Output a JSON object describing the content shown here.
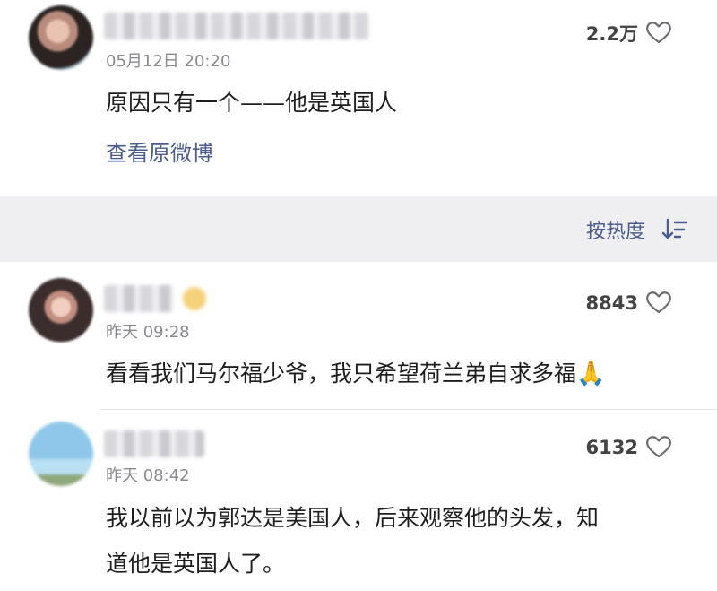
{
  "top_comment": {
    "time": "05月12日 20:20",
    "likes": "2.2万",
    "text": "原因只有一个——他是英国人",
    "view_original": "查看原微博"
  },
  "sort": {
    "label": "按热度"
  },
  "comments": [
    {
      "time": "昨天 09:28",
      "likes": "8843",
      "text": "看看我们马尔福少爷，我只希望荷兰弟自求多福",
      "emoji": "🙏"
    },
    {
      "time": "昨天 08:42",
      "likes": "6132",
      "text_line1": "我以前以为郭达是美国人，后来观察他的头发，知",
      "text_line2": "道他是英国人了。"
    }
  ],
  "icons": {
    "heart": "heart-outline-icon",
    "sort": "sort-descending-icon"
  },
  "colors": {
    "link": "#4a5b8c",
    "band": "#efeff1"
  }
}
